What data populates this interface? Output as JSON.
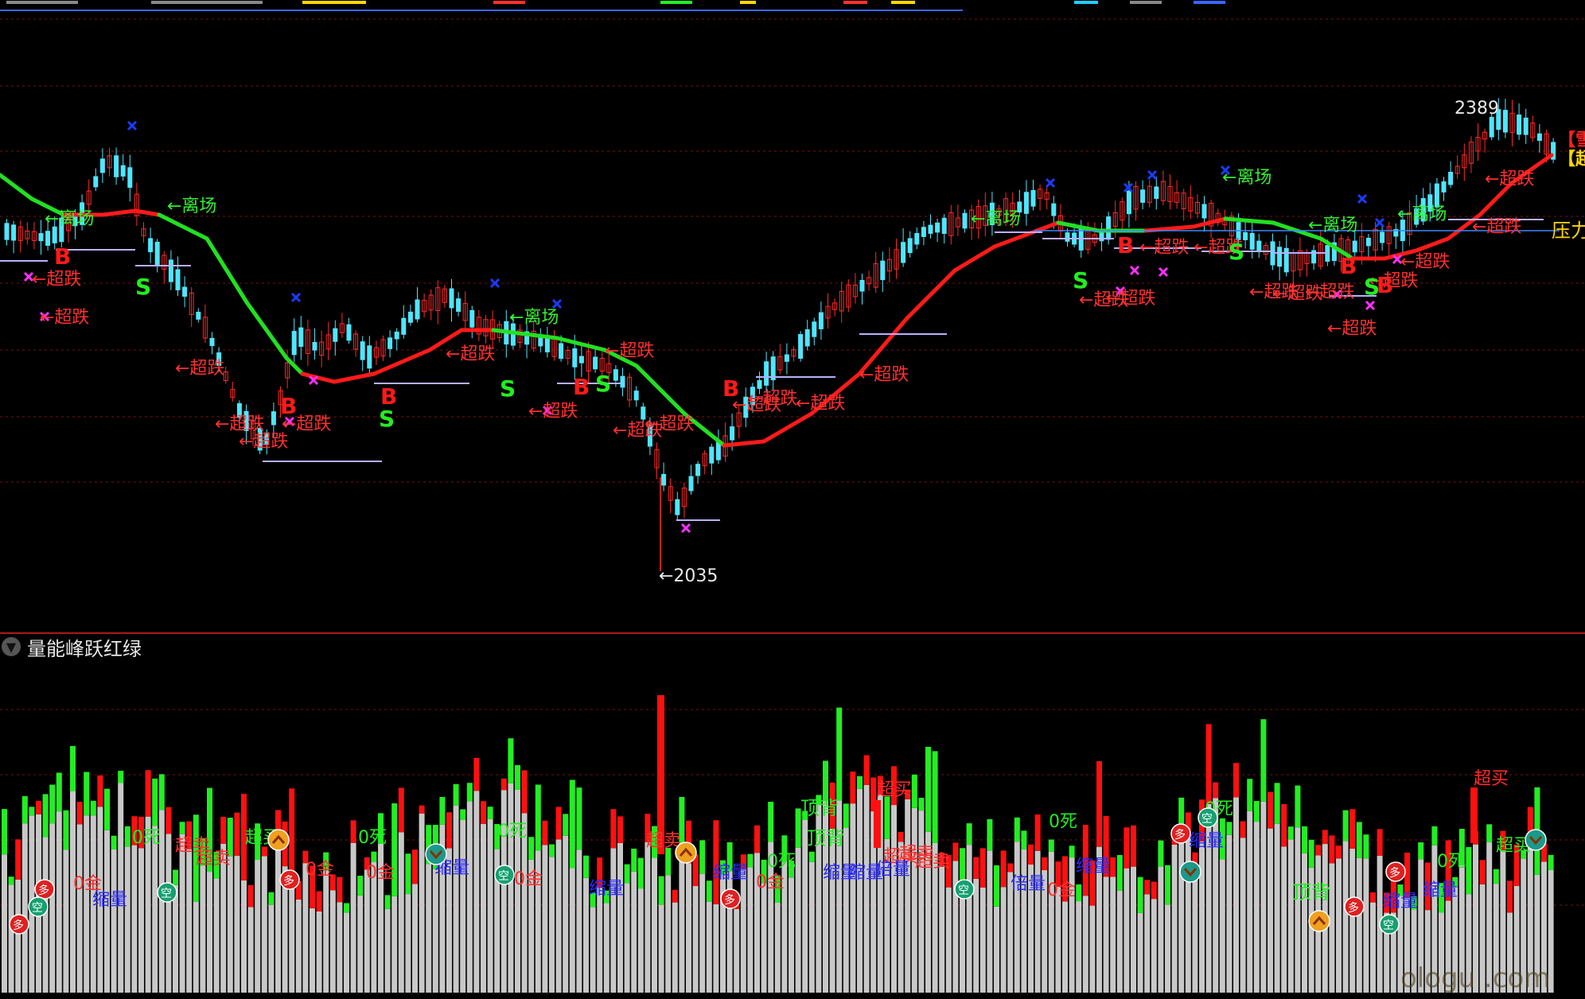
{
  "main_panel": {
    "price_low_label": "←2035",
    "price_high_label": "2389",
    "resistance_label": "压力",
    "edge_tag_1": "【雪",
    "edge_tag_2": "【超",
    "signals": {
      "leave_label": "←离场",
      "overfall_label": "←超跌",
      "buy_label": "B",
      "sell_label": "S"
    }
  },
  "sub_panel": {
    "title": "量能峰跃红绿",
    "labels": {
      "overbought": "超买",
      "oversold": "超卖",
      "zero_death": "0死",
      "zero_golden": "0金",
      "top_divergence": "顶背",
      "shrink_volume": "缩量",
      "double_volume": "倍量",
      "long_marker": "多",
      "short_marker": "空"
    }
  },
  "watermark": "ologu .com",
  "colors": {
    "background": "#000000",
    "up_candle": "#ff2a2a",
    "down_candle": "#4fe6ff",
    "trend_up": "#ff1a1a",
    "trend_down": "#22e022",
    "volume_up": "#ff1010",
    "volume_down": "#22ee22",
    "volume_base": "#c8c8c8",
    "grid": "#7a1010",
    "signal_overfall": "#ff3030",
    "signal_leave": "#33ee33",
    "marker_x_blue": "#1a3cff",
    "marker_x_magenta": "#ff30ff",
    "support_line": "#b8b0ff"
  },
  "icons": {
    "collapse": "chevron-down-icon",
    "long": "red-circle-marker-icon",
    "short": "teal-circle-marker-icon",
    "up": "orange-up-arrow-icon",
    "down": "teal-down-arrow-icon"
  }
}
